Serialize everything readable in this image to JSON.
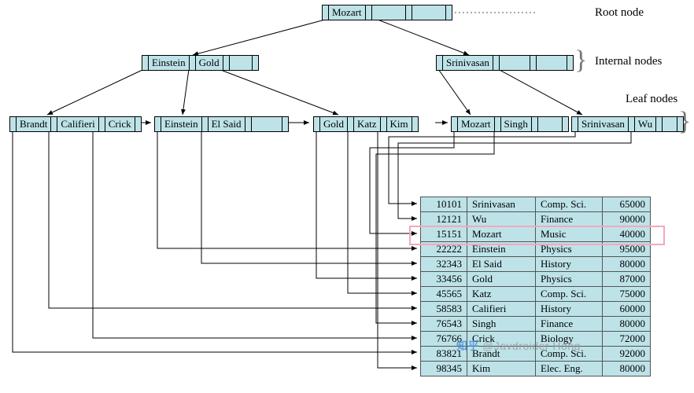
{
  "labels": {
    "root": "Root node",
    "internal": "Internal nodes",
    "leaf": "Leaf nodes"
  },
  "tree": {
    "root": {
      "keys": [
        "Mozart"
      ]
    },
    "internal": [
      {
        "keys": [
          "Einstein",
          "Gold"
        ]
      },
      {
        "keys": [
          "Srinivasan"
        ]
      }
    ],
    "leaves": [
      {
        "keys": [
          "Brandt",
          "Califieri",
          "Crick"
        ]
      },
      {
        "keys": [
          "Einstein",
          "El Said"
        ]
      },
      {
        "keys": [
          "Gold",
          "Katz",
          "Kim"
        ]
      },
      {
        "keys": [
          "Mozart",
          "Singh"
        ]
      },
      {
        "keys": [
          "Srinivasan",
          "Wu"
        ]
      }
    ]
  },
  "table": {
    "rows": [
      {
        "id": "10101",
        "name": "Srinivasan",
        "dept": "Comp. Sci.",
        "salary": "65000"
      },
      {
        "id": "12121",
        "name": "Wu",
        "dept": "Finance",
        "salary": "90000"
      },
      {
        "id": "15151",
        "name": "Mozart",
        "dept": "Music",
        "salary": "40000"
      },
      {
        "id": "22222",
        "name": "Einstein",
        "dept": "Physics",
        "salary": "95000"
      },
      {
        "id": "32343",
        "name": "El Said",
        "dept": "History",
        "salary": "80000"
      },
      {
        "id": "33456",
        "name": "Gold",
        "dept": "Physics",
        "salary": "87000"
      },
      {
        "id": "45565",
        "name": "Katz",
        "dept": "Comp. Sci.",
        "salary": "75000"
      },
      {
        "id": "58583",
        "name": "Califieri",
        "dept": "History",
        "salary": "60000"
      },
      {
        "id": "76543",
        "name": "Singh",
        "dept": "Finance",
        "salary": "80000"
      },
      {
        "id": "76766",
        "name": "Crick",
        "dept": "Biology",
        "salary": "72000"
      },
      {
        "id": "83821",
        "name": "Brandt",
        "dept": "Comp. Sci.",
        "salary": "92000"
      },
      {
        "id": "98345",
        "name": "Kim",
        "dept": "Elec. Eng.",
        "salary": "80000"
      }
    ]
  },
  "highlight_row_index": 2,
  "watermark": "@Javdroider Hong"
}
